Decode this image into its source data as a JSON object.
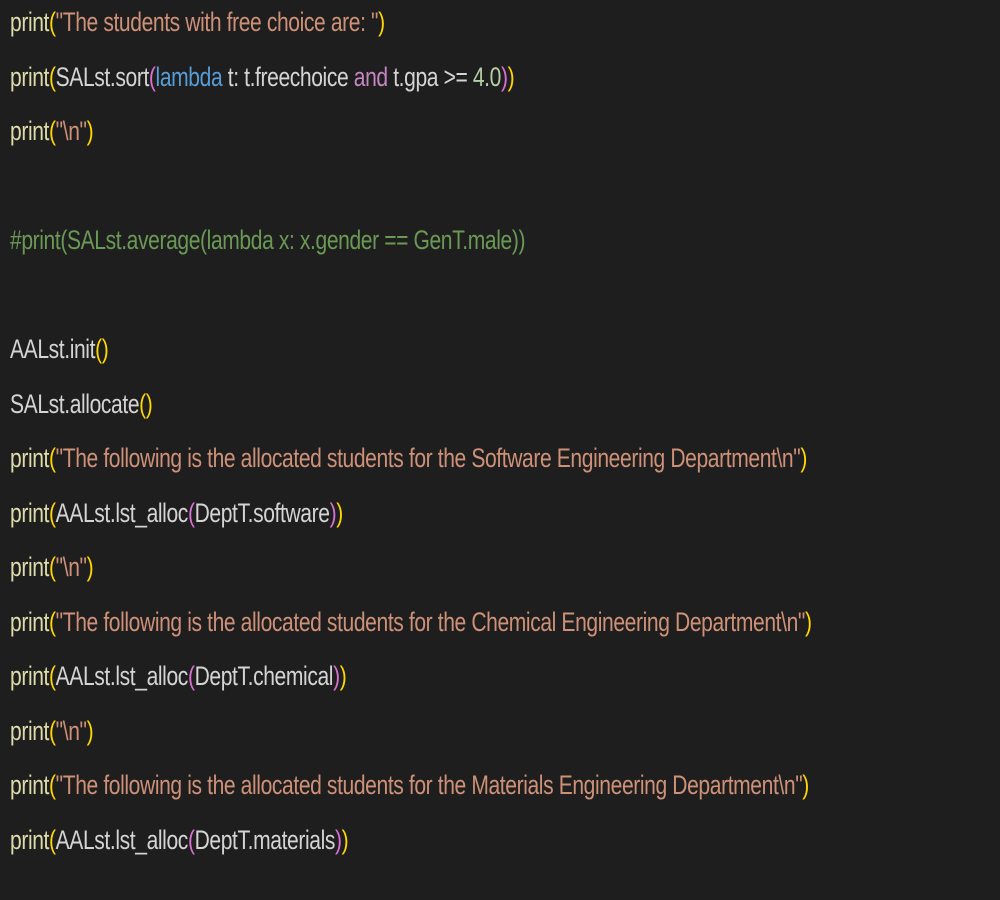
{
  "editor": {
    "lines": [
      {
        "tokens": [
          {
            "t": "print",
            "c": "fn"
          },
          {
            "t": "(",
            "c": "p1"
          },
          {
            "t": "\"The students with free choice are: \"",
            "c": "str"
          },
          {
            "t": ")",
            "c": "p1"
          }
        ]
      },
      {
        "tokens": [
          {
            "t": "print",
            "c": "fn"
          },
          {
            "t": "(",
            "c": "p1"
          },
          {
            "t": "SALst.sort",
            "c": "id"
          },
          {
            "t": "(",
            "c": "p2"
          },
          {
            "t": "lambda",
            "c": "kw-blue"
          },
          {
            "t": " t: t.freechoice ",
            "c": "id"
          },
          {
            "t": "and",
            "c": "kw-purple"
          },
          {
            "t": " t.gpa >= ",
            "c": "id"
          },
          {
            "t": "4.0",
            "c": "num"
          },
          {
            "t": ")",
            "c": "p2"
          },
          {
            "t": ")",
            "c": "p1"
          }
        ]
      },
      {
        "tokens": [
          {
            "t": "print",
            "c": "fn"
          },
          {
            "t": "(",
            "c": "p1"
          },
          {
            "t": "\"\\n\"",
            "c": "str"
          },
          {
            "t": ")",
            "c": "p1"
          }
        ]
      },
      {
        "tokens": []
      },
      {
        "tokens": [
          {
            "t": "#print(SALst.average(lambda x: x.gender == GenT.male))",
            "c": "cm"
          }
        ]
      },
      {
        "tokens": []
      },
      {
        "tokens": [
          {
            "t": "AALst.init",
            "c": "id"
          },
          {
            "t": "()",
            "c": "p1"
          }
        ]
      },
      {
        "tokens": [
          {
            "t": "SALst.allocate",
            "c": "id"
          },
          {
            "t": "()",
            "c": "p1"
          }
        ]
      },
      {
        "tokens": [
          {
            "t": "print",
            "c": "fn"
          },
          {
            "t": "(",
            "c": "p1"
          },
          {
            "t": "\"The following is the allocated students for the Software Engineering Department\\n\"",
            "c": "str"
          },
          {
            "t": ")",
            "c": "p1"
          }
        ]
      },
      {
        "tokens": [
          {
            "t": "print",
            "c": "fn"
          },
          {
            "t": "(",
            "c": "p1"
          },
          {
            "t": "AALst.lst_alloc",
            "c": "id"
          },
          {
            "t": "(",
            "c": "p2"
          },
          {
            "t": "DeptT.software",
            "c": "id"
          },
          {
            "t": ")",
            "c": "p2"
          },
          {
            "t": ")",
            "c": "p1"
          }
        ]
      },
      {
        "tokens": [
          {
            "t": "print",
            "c": "fn"
          },
          {
            "t": "(",
            "c": "p1"
          },
          {
            "t": "\"\\n\"",
            "c": "str"
          },
          {
            "t": ")",
            "c": "p1"
          }
        ]
      },
      {
        "tokens": [
          {
            "t": "print",
            "c": "fn"
          },
          {
            "t": "(",
            "c": "p1"
          },
          {
            "t": "\"The following is the allocated students for the Chemical Engineering Department\\n\"",
            "c": "str"
          },
          {
            "t": ")",
            "c": "p1"
          }
        ]
      },
      {
        "tokens": [
          {
            "t": "print",
            "c": "fn"
          },
          {
            "t": "(",
            "c": "p1"
          },
          {
            "t": "AALst.lst_alloc",
            "c": "id"
          },
          {
            "t": "(",
            "c": "p2"
          },
          {
            "t": "DeptT.chemical",
            "c": "id"
          },
          {
            "t": ")",
            "c": "p2"
          },
          {
            "t": ")",
            "c": "p1"
          }
        ]
      },
      {
        "tokens": [
          {
            "t": "print",
            "c": "fn"
          },
          {
            "t": "(",
            "c": "p1"
          },
          {
            "t": "\"\\n\"",
            "c": "str"
          },
          {
            "t": ")",
            "c": "p1"
          }
        ]
      },
      {
        "tokens": [
          {
            "t": "print",
            "c": "fn"
          },
          {
            "t": "(",
            "c": "p1"
          },
          {
            "t": "\"The following is the allocated students for the Materials Engineering Department\\n\"",
            "c": "str"
          },
          {
            "t": ")",
            "c": "p1"
          }
        ]
      },
      {
        "tokens": [
          {
            "t": "print",
            "c": "fn"
          },
          {
            "t": "(",
            "c": "p1"
          },
          {
            "t": "AALst.lst_alloc",
            "c": "id"
          },
          {
            "t": "(",
            "c": "p2"
          },
          {
            "t": "DeptT.materials",
            "c": "id"
          },
          {
            "t": ")",
            "c": "p2"
          },
          {
            "t": ")",
            "c": "p1"
          }
        ]
      }
    ]
  },
  "colors": {
    "background": "#1e1e1e",
    "function": "#dcdcaa",
    "string": "#ce9178",
    "keyword_blue": "#569cd6",
    "keyword_purple": "#c586c0",
    "number": "#b5cea8",
    "comment": "#6a9955",
    "identifier": "#d4d4d4",
    "bracket_1": "#ffd700",
    "bracket_2": "#da70d6"
  }
}
